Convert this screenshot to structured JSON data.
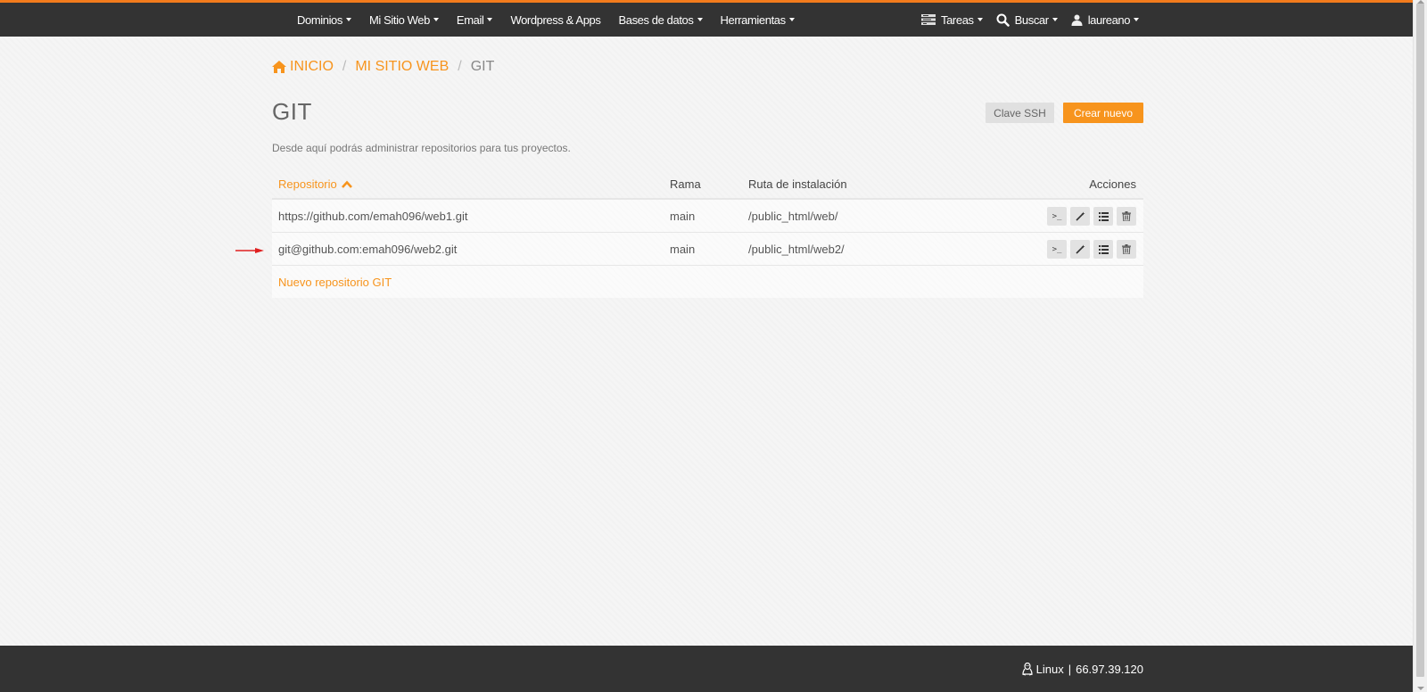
{
  "nav": {
    "left": [
      {
        "label": "Dominios"
      },
      {
        "label": "Mi Sitio Web"
      },
      {
        "label": "Email"
      },
      {
        "label": "Wordpress & Apps"
      },
      {
        "label": "Bases de datos"
      },
      {
        "label": "Herramientas"
      }
    ],
    "right": {
      "tasks": "Tareas",
      "search": "Buscar",
      "user": "laureano"
    }
  },
  "breadcrumb": {
    "home": "INICIO",
    "site": "MI SITIO WEB",
    "current": "GIT"
  },
  "page": {
    "title": "GIT",
    "subtitle": "Desde aquí podrás administrar repositorios para tus proyectos.",
    "ssh_button": "Clave SSH",
    "new_button": "Crear nuevo"
  },
  "table": {
    "headers": {
      "repo": "Repositorio",
      "rama": "Rama",
      "ruta": "Ruta de instalación",
      "acciones": "Acciones"
    },
    "rows": [
      {
        "repo": "https://github.com/emah096/web1.git",
        "rama": "main",
        "ruta": "/public_html/web/"
      },
      {
        "repo": "git@github.com:emah096/web2.git",
        "rama": "main",
        "ruta": "/public_html/web2/"
      }
    ],
    "new_repo_link": "Nuevo repositorio GIT"
  },
  "footer": {
    "os": "Linux",
    "separator": "|",
    "ip": "66.97.39.120"
  },
  "colors": {
    "accent": "#f7941d",
    "topbar": "#333333",
    "arrow": "#e02020"
  },
  "icons": {
    "terminal": ">_",
    "home": "home-icon",
    "sort": "chevron-up-icon"
  }
}
